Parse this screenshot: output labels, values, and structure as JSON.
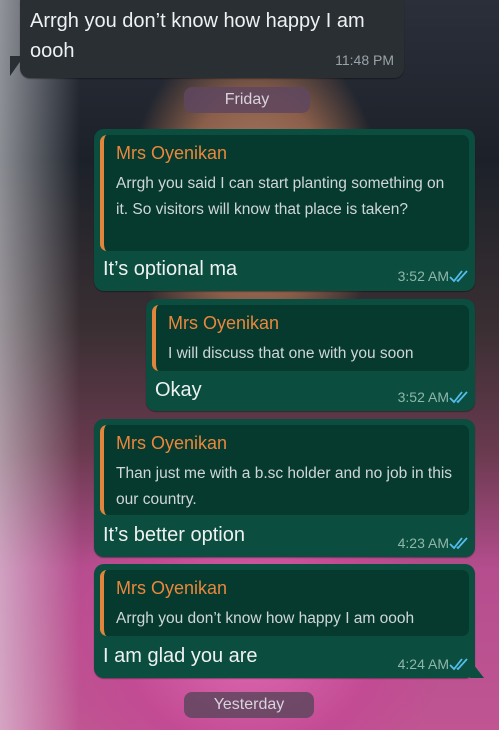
{
  "chat": {
    "top_message": {
      "text": "Arrgh you don’t know how happy I am oooh",
      "time": "11:48 PM"
    },
    "day_friday": "Friday",
    "day_yesterday": "Yesterday",
    "messages": [
      {
        "quote_name": "Mrs Oyenikan",
        "quote_text": "Arrgh you said I can start planting something on it. So visitors will know that place is taken?",
        "text": "It’s optional ma",
        "time": "3:52 AM"
      },
      {
        "quote_name": "Mrs Oyenikan",
        "quote_text": "I will discuss that one with you soon",
        "text": "Okay",
        "time": "3:52 AM"
      },
      {
        "quote_name": "Mrs Oyenikan",
        "quote_text": "Than just me with a b.sc holder and no job in this our country.",
        "text": "It’s better option",
        "time": "4:23 AM"
      },
      {
        "quote_name": "Mrs Oyenikan",
        "quote_text": "Arrgh you don’t know how happy I am oooh",
        "text": "I am glad you are",
        "time": "4:24 AM"
      }
    ],
    "colors": {
      "incoming_bubble": "#2a2f34",
      "outgoing_bubble": "#0b4d3f",
      "quote_accent": "#e1853c",
      "read_ticks": "#53bdeb"
    },
    "icons": [
      "double-check-read-icon"
    ]
  }
}
